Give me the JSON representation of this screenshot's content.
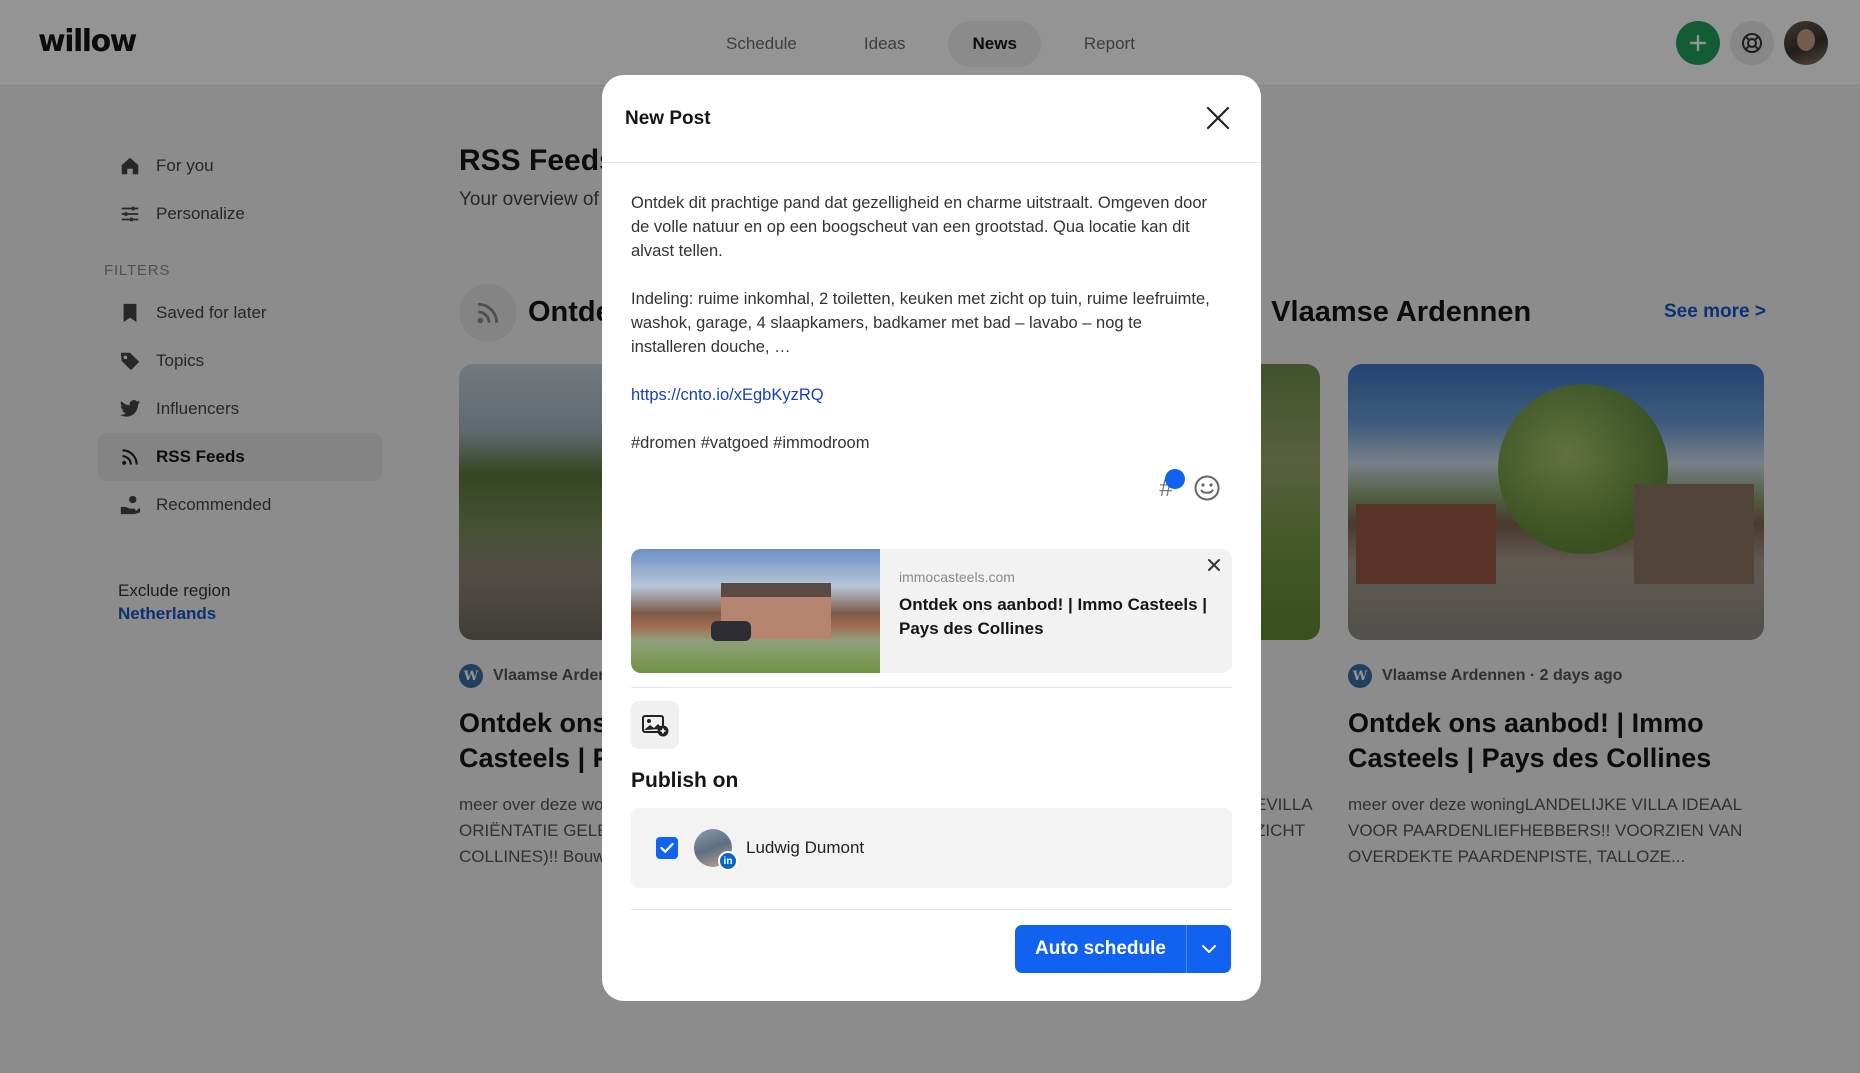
{
  "app": {
    "logo": "willow",
    "nav": [
      {
        "label": "Schedule",
        "active": false
      },
      {
        "label": "Ideas",
        "active": false
      },
      {
        "label": "News",
        "active": true
      },
      {
        "label": "Report",
        "active": false
      }
    ],
    "icons": {
      "add": "plus-icon",
      "help": "lifebuoy-icon",
      "profile": "avatar"
    },
    "colors": {
      "accent": "#1162f0",
      "add_button": "#1fa15a",
      "link": "#1457c8"
    }
  },
  "sidebar": {
    "items_top": [
      {
        "label": "For you",
        "icon": "home-icon"
      },
      {
        "label": "Personalize",
        "icon": "sliders-icon"
      }
    ],
    "filters_heading": "FILTERS",
    "items_filters": [
      {
        "label": "Saved for later",
        "icon": "bookmark-icon",
        "active": false
      },
      {
        "label": "Topics",
        "icon": "tag-icon",
        "active": false
      },
      {
        "label": "Influencers",
        "icon": "twitter-icon",
        "active": false
      },
      {
        "label": "RSS Feeds",
        "icon": "rss-icon",
        "active": true
      },
      {
        "label": "Recommended",
        "icon": "hand-coin-icon",
        "active": false
      }
    ],
    "exclude_label": "Exclude region",
    "exclude_value": "Netherlands"
  },
  "main": {
    "title": "RSS Feeds",
    "subtitle": "Your overview of",
    "feed_title_left": "Ontde",
    "feed_title_right": "| Vlaamse Ardennen",
    "see_more": "See more >",
    "cards": [
      {
        "source": "Vlaamse Arder",
        "title_lines": [
          "Ontdek ons",
          "Casteels | P"
        ],
        "desc_lines": [
          "meer over deze wor",
          "ORIËNTATIE GELEG",
          "COLLINES)!! Bouwj"
        ]
      },
      {
        "desc_lines": [
          "EVILLA",
          "ZICHT",
          "."
        ]
      },
      {
        "source": "Vlaamse Ardennen · 2 days ago",
        "title": "Ontdek ons aanbod! | Immo Casteels | Pays des Collines",
        "desc": "meer over deze woningLANDELIJKE VILLA IDEAAL VOOR PAARDENLIEFHEBBERS!! VOORZIEN VAN OVERDEKTE PAARDENPISTE, TALLOZE..."
      }
    ]
  },
  "modal": {
    "title": "New Post",
    "post": {
      "para1": "Ontdek dit prachtige pand dat gezelligheid en charme uitstraalt. Omgeven door de volle natuur en op een boogscheut van een grootstad. Qua locatie kan dit alvast tellen.",
      "para2": "Indeling: ruime inkomhal, 2 toiletten, keuken met zicht op tuin, ruime leefruimte, washok, garage, 4 slaapkamers, badkamer met bad – lavabo – nog te installeren douche, …",
      "link": "https://cnto.io/xEgbKyzRQ",
      "hashtags": "#dromen #vatgoed #immodroom"
    },
    "tools": {
      "hashtag": "#",
      "emoji_icon": "emoji-icon"
    },
    "preview": {
      "domain": "immocasteels.com",
      "title": "Ontdek ons aanbod! | Immo Casteels | Pays des Collines"
    },
    "publish_on": "Publish on",
    "account": {
      "name": "Ludwig Dumont",
      "network": "in",
      "checked": true
    },
    "schedule_label": "Auto schedule"
  }
}
